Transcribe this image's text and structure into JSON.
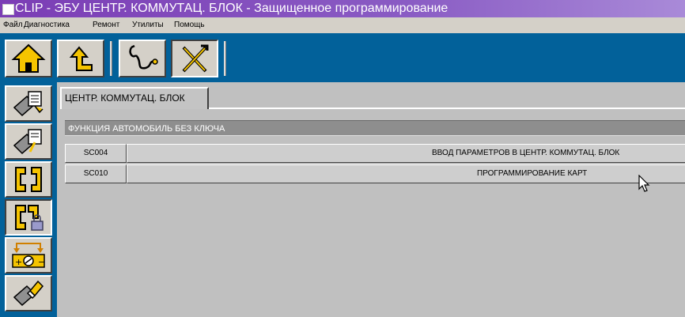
{
  "window": {
    "title": "CLIP - ЭБУ ЦЕНТР. КОММУТАЦ. БЛОК - Защищенное программирование"
  },
  "menu": {
    "items": [
      "Файл",
      "Диагностика",
      "Ремонт",
      "Утилиты",
      "Помощь"
    ]
  },
  "toolbar": {
    "buttons": [
      {
        "icon": "home-icon"
      },
      {
        "icon": "back-arrow-icon"
      },
      {
        "icon": "diagnostic-probe-icon"
      },
      {
        "icon": "repair-tools-icon",
        "pressed": true
      }
    ]
  },
  "sidebar": {
    "buttons": [
      {
        "icon": "ecu-identification-icon"
      },
      {
        "icon": "ecu-parameters-icon"
      },
      {
        "icon": "connector-icon"
      },
      {
        "icon": "connector-lock-icon",
        "pressed": true
      },
      {
        "icon": "battery-resistor-icon"
      },
      {
        "icon": "ecu-erase-icon"
      }
    ]
  },
  "content": {
    "tab_label": "ЦЕНТР. КОММУТАЦ. БЛОК",
    "function_header": "ФУНКЦИЯ АВТОМОБИЛЬ БЕЗ КЛЮЧА",
    "rows": [
      {
        "code": "SC004",
        "description": "ВВОД ПАРАМЕТРОВ В ЦЕНТР. КОММУТАЦ. БЛОК"
      },
      {
        "code": "SC010",
        "description": "ПРОГРАММИРОВАНИЕ КАРТ"
      }
    ]
  },
  "colors": {
    "toolbar_bg": "#02619a",
    "title_bg": "#7b3db5",
    "icon_yellow": "#f5c400"
  }
}
